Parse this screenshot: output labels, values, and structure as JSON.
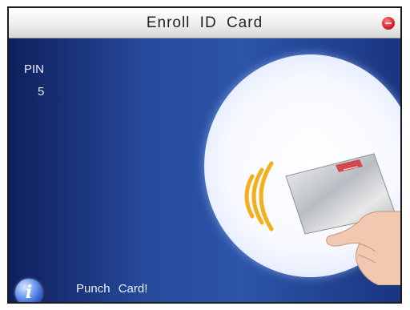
{
  "titlebar": {
    "title": "Enroll ID Card",
    "record_icon": "record-icon",
    "record_color": "#d9272e"
  },
  "form": {
    "pin_label": "PIN",
    "pin_value": "5"
  },
  "illustration": {
    "icons": [
      "card-reader-waves-icon",
      "id-card-icon",
      "hand-icon"
    ],
    "wave_color": "#f2b01b",
    "card_stripe_color": "#d0343a"
  },
  "status": {
    "icon": "info-icon",
    "message": "Punch Card!"
  },
  "colors": {
    "background": "#1a2f78",
    "titlebar": "#efefef",
    "text": "#e9eef9"
  }
}
